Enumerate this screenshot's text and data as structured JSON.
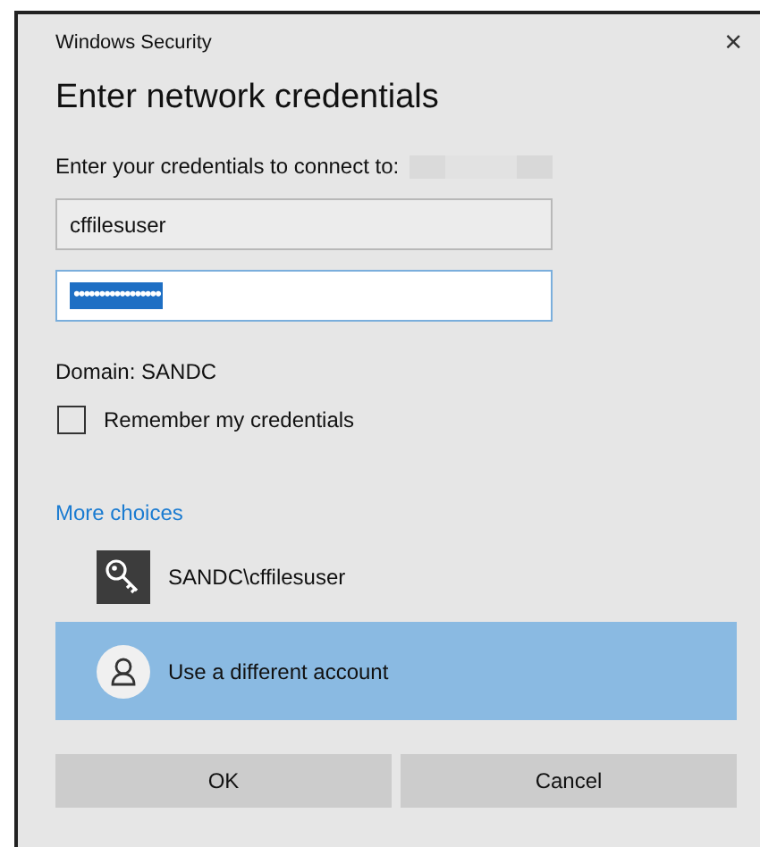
{
  "window": {
    "title": "Windows Security",
    "close": "×"
  },
  "heading": "Enter network credentials",
  "prompt": "Enter your credentials to connect to:",
  "username": {
    "value": "cffilesuser",
    "focused": false
  },
  "password": {
    "value": "•••••••••••••••••",
    "focused": true,
    "text_selected": true
  },
  "domain": "Domain: SANDC",
  "remember": {
    "label": "Remember my credentials",
    "checked": false
  },
  "more_choices": "More choices",
  "accounts": [
    {
      "kind": "key",
      "label": "SANDC\\cffilesuser",
      "selected": false
    },
    {
      "kind": "person",
      "label": "Use a different account",
      "selected": true
    }
  ],
  "buttons": [
    "OK",
    "Cancel"
  ]
}
